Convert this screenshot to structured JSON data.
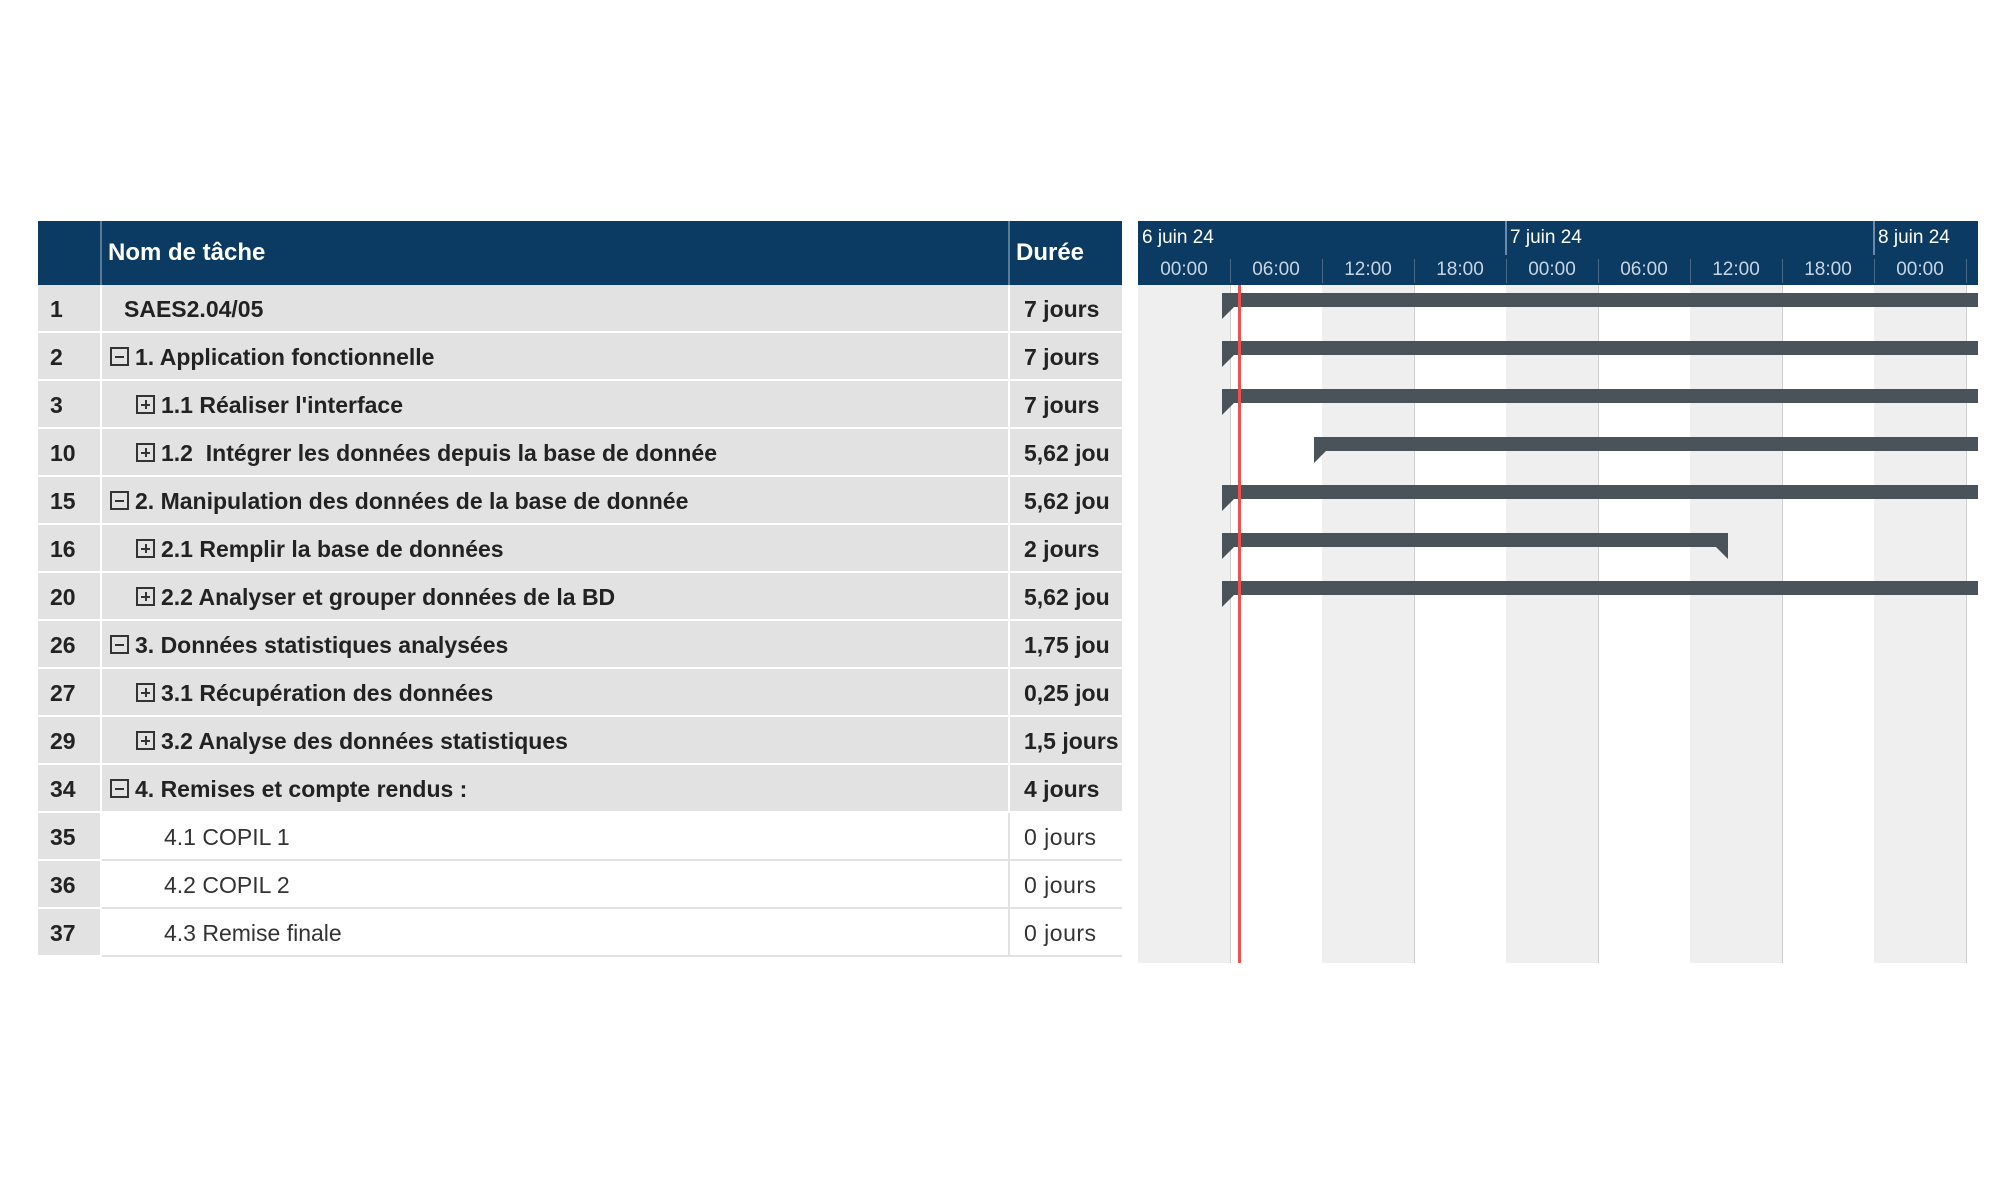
{
  "table": {
    "columns": {
      "id": "",
      "name": "Nom de tâche",
      "duration": "Durée"
    },
    "rows": [
      {
        "id": "1",
        "name": "SAES2.04/05",
        "duration": "7 jours",
        "indent": 0,
        "toggle": "none",
        "type": "summary"
      },
      {
        "id": "2",
        "name": "1. Application fonctionnelle",
        "duration": "7 jours",
        "indent": 0,
        "toggle": "minus",
        "type": "summary"
      },
      {
        "id": "3",
        "name": "1.1 Réaliser l'interface",
        "duration": "7 jours",
        "indent": 1,
        "toggle": "plus",
        "type": "summary"
      },
      {
        "id": "10",
        "name": "1.2  Intégrer les données depuis la base de donnée",
        "duration": "5,62 jou",
        "indent": 1,
        "toggle": "plus",
        "type": "summary"
      },
      {
        "id": "15",
        "name": "2. Manipulation des données de la base de donnée",
        "duration": "5,62 jou",
        "indent": 0,
        "toggle": "minus",
        "type": "summary"
      },
      {
        "id": "16",
        "name": "2.1 Remplir la base de données",
        "duration": "2 jours",
        "indent": 1,
        "toggle": "plus",
        "type": "summary"
      },
      {
        "id": "20",
        "name": "2.2 Analyser et grouper données de la BD",
        "duration": "5,62 jou",
        "indent": 1,
        "toggle": "plus",
        "type": "summary"
      },
      {
        "id": "26",
        "name": "3. Données statistiques analysées",
        "duration": "1,75 jou",
        "indent": 0,
        "toggle": "minus",
        "type": "summary"
      },
      {
        "id": "27",
        "name": "3.1 Récupération des données",
        "duration": "0,25 jou",
        "indent": 1,
        "toggle": "plus",
        "type": "summary"
      },
      {
        "id": "29",
        "name": "3.2 Analyse des données statistiques",
        "duration": "1,5 jours",
        "indent": 1,
        "toggle": "plus",
        "type": "summary"
      },
      {
        "id": "34",
        "name": "4. Remises et compte rendus :",
        "duration": "4 jours",
        "indent": 0,
        "toggle": "minus",
        "type": "summary"
      },
      {
        "id": "35",
        "name": "4.1 COPIL 1",
        "duration": "0 jours",
        "indent": 2,
        "toggle": "none",
        "type": "leaf"
      },
      {
        "id": "36",
        "name": "4.2 COPIL 2",
        "duration": "0 jours",
        "indent": 2,
        "toggle": "none",
        "type": "leaf"
      },
      {
        "id": "37",
        "name": "4.3 Remise finale",
        "duration": "0 jours",
        "indent": 2,
        "toggle": "none",
        "type": "leaf"
      }
    ]
  },
  "timescale": {
    "dates": [
      "6 juin 24",
      "7 juin 24",
      "8 juin 24"
    ],
    "times": [
      "00:00",
      "06:00",
      "12:00",
      "18:00",
      "00:00",
      "06:00",
      "12:00",
      "18:00",
      "00:00"
    ]
  },
  "gantt": {
    "today_hour": 6.5,
    "bars": [
      {
        "row": 0,
        "start_hour": 5.5,
        "end_hour": null
      },
      {
        "row": 1,
        "start_hour": 5.5,
        "end_hour": null
      },
      {
        "row": 2,
        "start_hour": 5.5,
        "end_hour": null
      },
      {
        "row": 3,
        "start_hour": 11.5,
        "end_hour": null
      },
      {
        "row": 4,
        "start_hour": 5.5,
        "end_hour": null
      },
      {
        "row": 5,
        "start_hour": 5.5,
        "end_hour": 38.5
      },
      {
        "row": 6,
        "start_hour": 5.5,
        "end_hour": null
      }
    ]
  },
  "colors": {
    "header": "#0b3b62",
    "summary_row": "#e2e2e2",
    "bar": "#4a525a",
    "today_line": "#f05050"
  }
}
